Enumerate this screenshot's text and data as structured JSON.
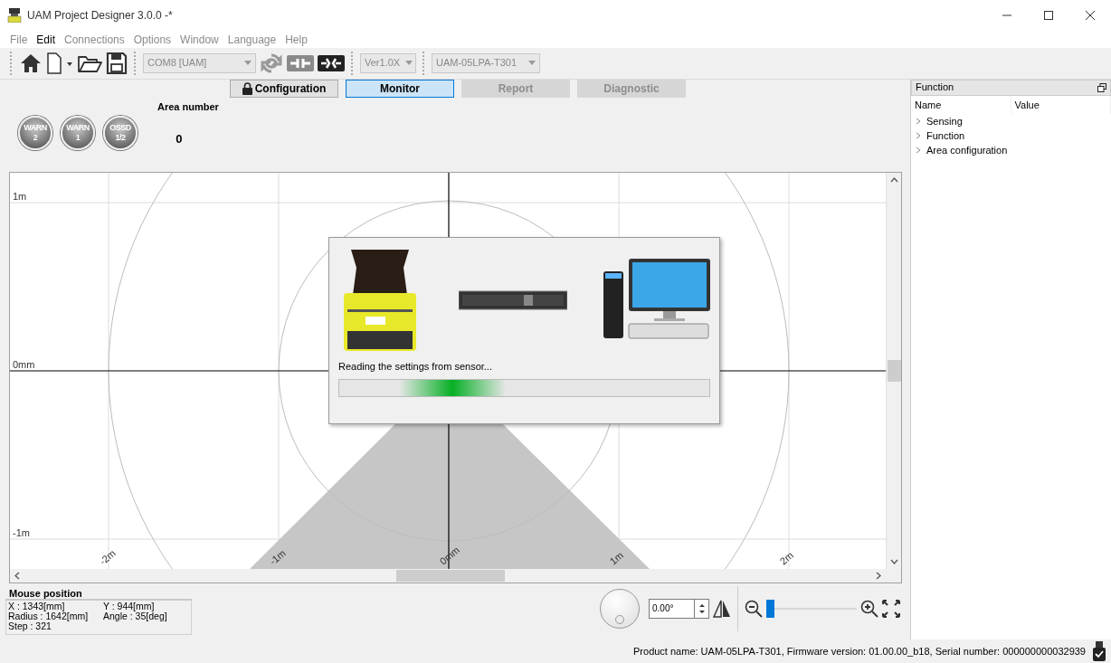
{
  "window": {
    "title": "UAM Project Designer 3.0.0 -*"
  },
  "menu": [
    {
      "label": "File",
      "disabled": true
    },
    {
      "label": "Edit",
      "disabled": false
    },
    {
      "label": "Connections",
      "disabled": true
    },
    {
      "label": "Options",
      "disabled": true
    },
    {
      "label": "Window",
      "disabled": true
    },
    {
      "label": "Language",
      "disabled": true
    },
    {
      "label": "Help",
      "disabled": true
    }
  ],
  "toolbar": {
    "dropdowns": [
      {
        "value": "COM8 [UAM]",
        "disabled": true
      },
      {
        "value": "Ver1.0X",
        "disabled": true
      },
      {
        "value": "UAM-05LPA-T301",
        "disabled": true
      }
    ]
  },
  "mode_tabs": [
    {
      "label": "Configuration",
      "locked": true,
      "selected": false,
      "disabled": false
    },
    {
      "label": "Monitor",
      "locked": false,
      "selected": true,
      "disabled": false
    },
    {
      "label": "Report",
      "locked": false,
      "selected": false,
      "disabled": true
    },
    {
      "label": "Diagnostic",
      "locked": false,
      "selected": false,
      "disabled": true
    }
  ],
  "indicators": [
    {
      "lines": [
        "WARN",
        "2"
      ],
      "on": false
    },
    {
      "lines": [
        "WARN",
        "1"
      ],
      "on": false
    },
    {
      "lines": [
        "OSSD",
        "1/2"
      ],
      "on": false
    }
  ],
  "area_number": {
    "label": "Area number",
    "value": "0"
  },
  "canvas": {
    "y_labels": [
      "1m",
      "0mm",
      "-1m"
    ],
    "x_labels": [
      "-2m",
      "-1m",
      "0mm",
      "1m",
      "2m"
    ]
  },
  "dialog": {
    "message": "Reading the settings from sensor...",
    "progress": {
      "level": 0.45
    }
  },
  "function_panel": {
    "title": "Function",
    "columns": [
      "Name",
      "Value"
    ],
    "items": [
      {
        "label": "Sensing",
        "expanded": false
      },
      {
        "label": "Function",
        "expanded": false
      },
      {
        "label": "Area configuration",
        "expanded": false
      }
    ]
  },
  "mouse_position": {
    "title": "Mouse position",
    "x": "X : 1343[mm]",
    "y": "Y : 944[mm]",
    "radius": "Radius : 1642[mm]",
    "angle": "Angle : 35[deg]",
    "step": "Step : 321"
  },
  "view_controls": {
    "rotation": "0.00°",
    "zoom": {
      "level": 0.0
    }
  },
  "status_bar": {
    "text": "Product name: UAM-05LPA-T301, Firmware version: 01.00.00_b18, Serial number: 000000000032939"
  }
}
